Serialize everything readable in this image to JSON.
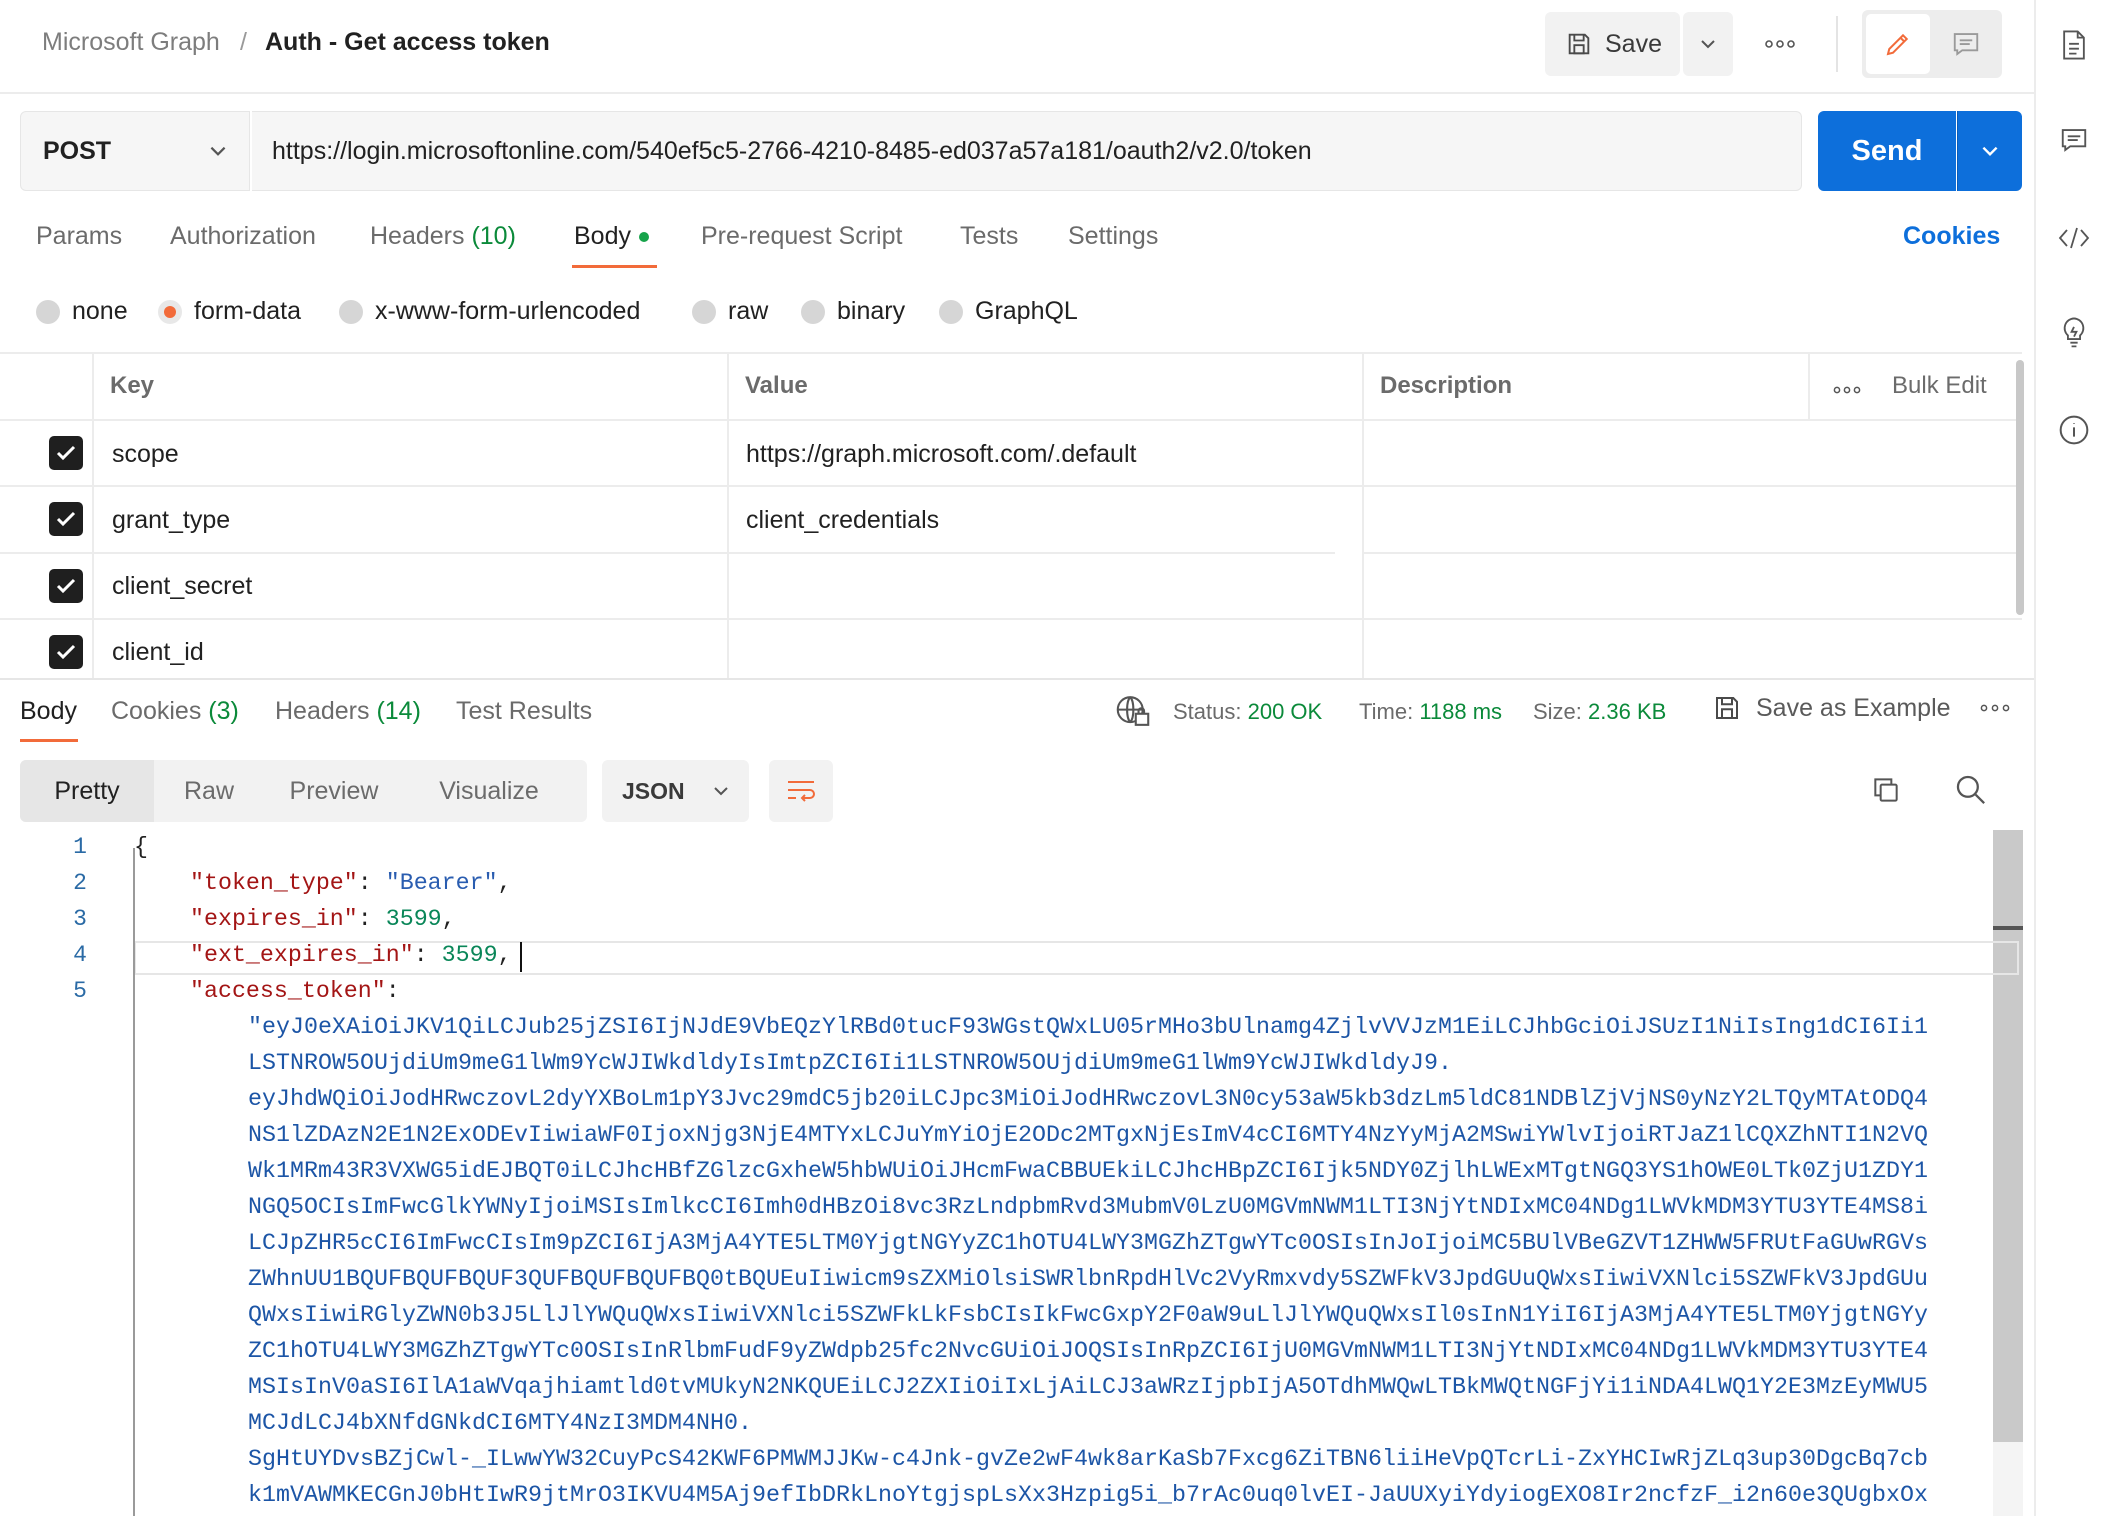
{
  "header": {
    "breadcrumb_parent": "Microsoft Graph",
    "breadcrumb_separator": "/",
    "title": "Auth - Get access token",
    "save_label": "Save"
  },
  "request": {
    "method": "POST",
    "url": "https://login.microsoftonline.com/540ef5c5-2766-4210-8485-ed037a57a181/oauth2/v2.0/token",
    "send_label": "Send",
    "tabs": {
      "params": "Params",
      "authorization": "Authorization",
      "headers": "Headers",
      "headers_count": "(10)",
      "body": "Body",
      "prerequest": "Pre-request Script",
      "tests": "Tests",
      "settings": "Settings"
    },
    "cookies_label": "Cookies",
    "body_types": [
      "none",
      "form-data",
      "x-www-form-urlencoded",
      "raw",
      "binary",
      "GraphQL"
    ],
    "body_type_selected": "form-data",
    "table": {
      "headers": {
        "key": "Key",
        "value": "Value",
        "description": "Description",
        "bulk_edit": "Bulk Edit"
      },
      "rows": [
        {
          "checked": true,
          "key": "scope",
          "value": "https://graph.microsoft.com/.default",
          "description": ""
        },
        {
          "checked": true,
          "key": "grant_type",
          "value": "client_credentials",
          "description": ""
        },
        {
          "checked": true,
          "key": "client_secret",
          "value": "",
          "description": ""
        },
        {
          "checked": true,
          "key": "client_id",
          "value": "",
          "description": ""
        }
      ]
    }
  },
  "response": {
    "tabs": {
      "body": "Body",
      "cookies": "Cookies",
      "cookies_count": "(3)",
      "headers": "Headers",
      "headers_count": "(14)",
      "test_results": "Test Results"
    },
    "status_label": "Status:",
    "status_value": "200 OK",
    "time_label": "Time:",
    "time_value": "1188 ms",
    "size_label": "Size:",
    "size_value": "2.36 KB",
    "save_example_label": "Save as Example",
    "views": [
      "Pretty",
      "Raw",
      "Preview",
      "Visualize"
    ],
    "view_selected": "Pretty",
    "format": "JSON",
    "code": {
      "line_numbers": [
        "1",
        "2",
        "3",
        "4",
        "5"
      ],
      "open_brace": "{",
      "token_type_key": "\"token_type\"",
      "token_type_value": "\"Bearer\"",
      "expires_in_key": "\"expires_in\"",
      "expires_in_value": "3599",
      "ext_expires_in_key": "\"ext_expires_in\"",
      "ext_expires_in_value": "3599",
      "access_token_key": "\"access_token\"",
      "access_token_lines": [
        "\"eyJ0eXAiOiJKV1QiLCJub25jZSI6IjNJdE9VbEQzYlRBd0tucF93WGstQWxLU05rMHo3bUlnamg4ZjlvVVJzM1EiLCJhbGciOiJSUzI1NiIsIng1dCI6Ii1",
        "LSTNROW5OUjdiUm9meG1lWm9YcWJIWkdldyIsImtpZCI6Ii1LSTNROW5OUjdiUm9meG1lWm9YcWJIWkdldyJ9.",
        "eyJhdWQiOiJodHRwczovL2dyYXBoLm1pY3Jvc29mdC5jb20iLCJpc3MiOiJodHRwczovL3N0cy53aW5kb3dzLm5ldC81NDBlZjVjNS0yNzY2LTQyMTAtODQ4",
        "NS1lZDAzN2E1N2ExODEvIiwiaWF0IjoxNjg3NjE4MTYxLCJuYmYiOjE2ODc2MTgxNjEsImV4cCI6MTY4NzYyMjA2MSwiYWlvIjoiRTJaZ1lCQXZhNTI1N2VQ",
        "Wk1MRm43R3VXWG5idEJBQT0iLCJhcHBfZGlzcGxheW5hbWUiOiJHcmFwaCBBUEkiLCJhcHBpZCI6Ijk5NDY0ZjlhLWExMTgtNGQ3YS1hOWE0LTk0ZjU1ZDY1",
        "NGQ5OCIsImFwcGlkYWNyIjoiMSIsImlkcCI6Imh0dHBzOi8vc3RzLndpbmRvd3MubmV0LzU0MGVmNWM1LTI3NjYtNDIxMC04NDg1LWVkMDM3YTU3YTE4MS8i",
        "LCJpZHR5cCI6ImFwcCIsIm9pZCI6IjA3MjA4YTE5LTM0YjgtNGYyZC1hOTU4LWY3MGZhZTgwYTc0OSIsInJoIjoiMC5BUlVBeGZVT1ZHWW5FRUtFaGUwRGVs",
        "ZWhnUU1BQUFBQUFBQUF3QUFBQUFBQUFBQ0tBQUEuIiwicm9sZXMiOlsiSWRlbnRpdHlVc2VyRmxvdy5SZWFkV3JpdGUuQWxsIiwiVXNlci5SZWFkV3JpdGUu",
        "QWxsIiwiRGlyZWN0b3J5LlJlYWQuQWxsIiwiVXNlci5SZWFkLkFsbCIsIkFwcGxpY2F0aW9uLlJlYWQuQWxsIl0sInN1YiI6IjA3MjA4YTE5LTM0YjgtNGYy",
        "ZC1hOTU4LWY3MGZhZTgwYTc0OSIsInRlbmFudF9yZWdpb25fc2NvcGUiOiJOQSIsInRpZCI6IjU0MGVmNWM1LTI3NjYtNDIxMC04NDg1LWVkMDM3YTU3YTE4",
        "MSIsInV0aSI6IlA1aWVqajhiamtld0tvMUkyN2NKQUEiLCJ2ZXIiOiIxLjAiLCJ3aWRzIjpbIjA5OTdhMWQwLTBkMWQtNGFjYi1iNDA4LWQ1Y2E3MzEyMWU5",
        "MCJdLCJ4bXNfdGNkdCI6MTY4NzI3MDM4NH0.",
        "SgHtUYDvsBZjCwl-_ILwwYW32CuyPcS42KWF6PMWMJJKw-c4Jnk-gvZe2wF4wk8arKaSb7Fxcg6ZiTBN6liiHeVpQTcrLi-ZxYHCIwRjZLq3up30DgcBq7cb",
        "k1mVAWMKECGnJ0bHtIwR9jtMrO3IKVU4M5Aj9efIbDRkLnoYtgjspLsXx3Hzpig5i_b7rAc0uq0lvEI-JaUUXyiYdyiogEXO8Ir2ncfzF_i2n60e3QUgbxOx"
      ]
    }
  },
  "icons": {
    "save": "floppy-disk-icon",
    "edit": "pencil-icon",
    "comment": "comment-icon",
    "copy": "copy-icon",
    "search": "search-icon",
    "wrap": "wrap-lines-icon"
  },
  "colors": {
    "accent": "#0d6fdb",
    "brand_orange": "#f26b3a",
    "success": "#0b8a3a"
  }
}
